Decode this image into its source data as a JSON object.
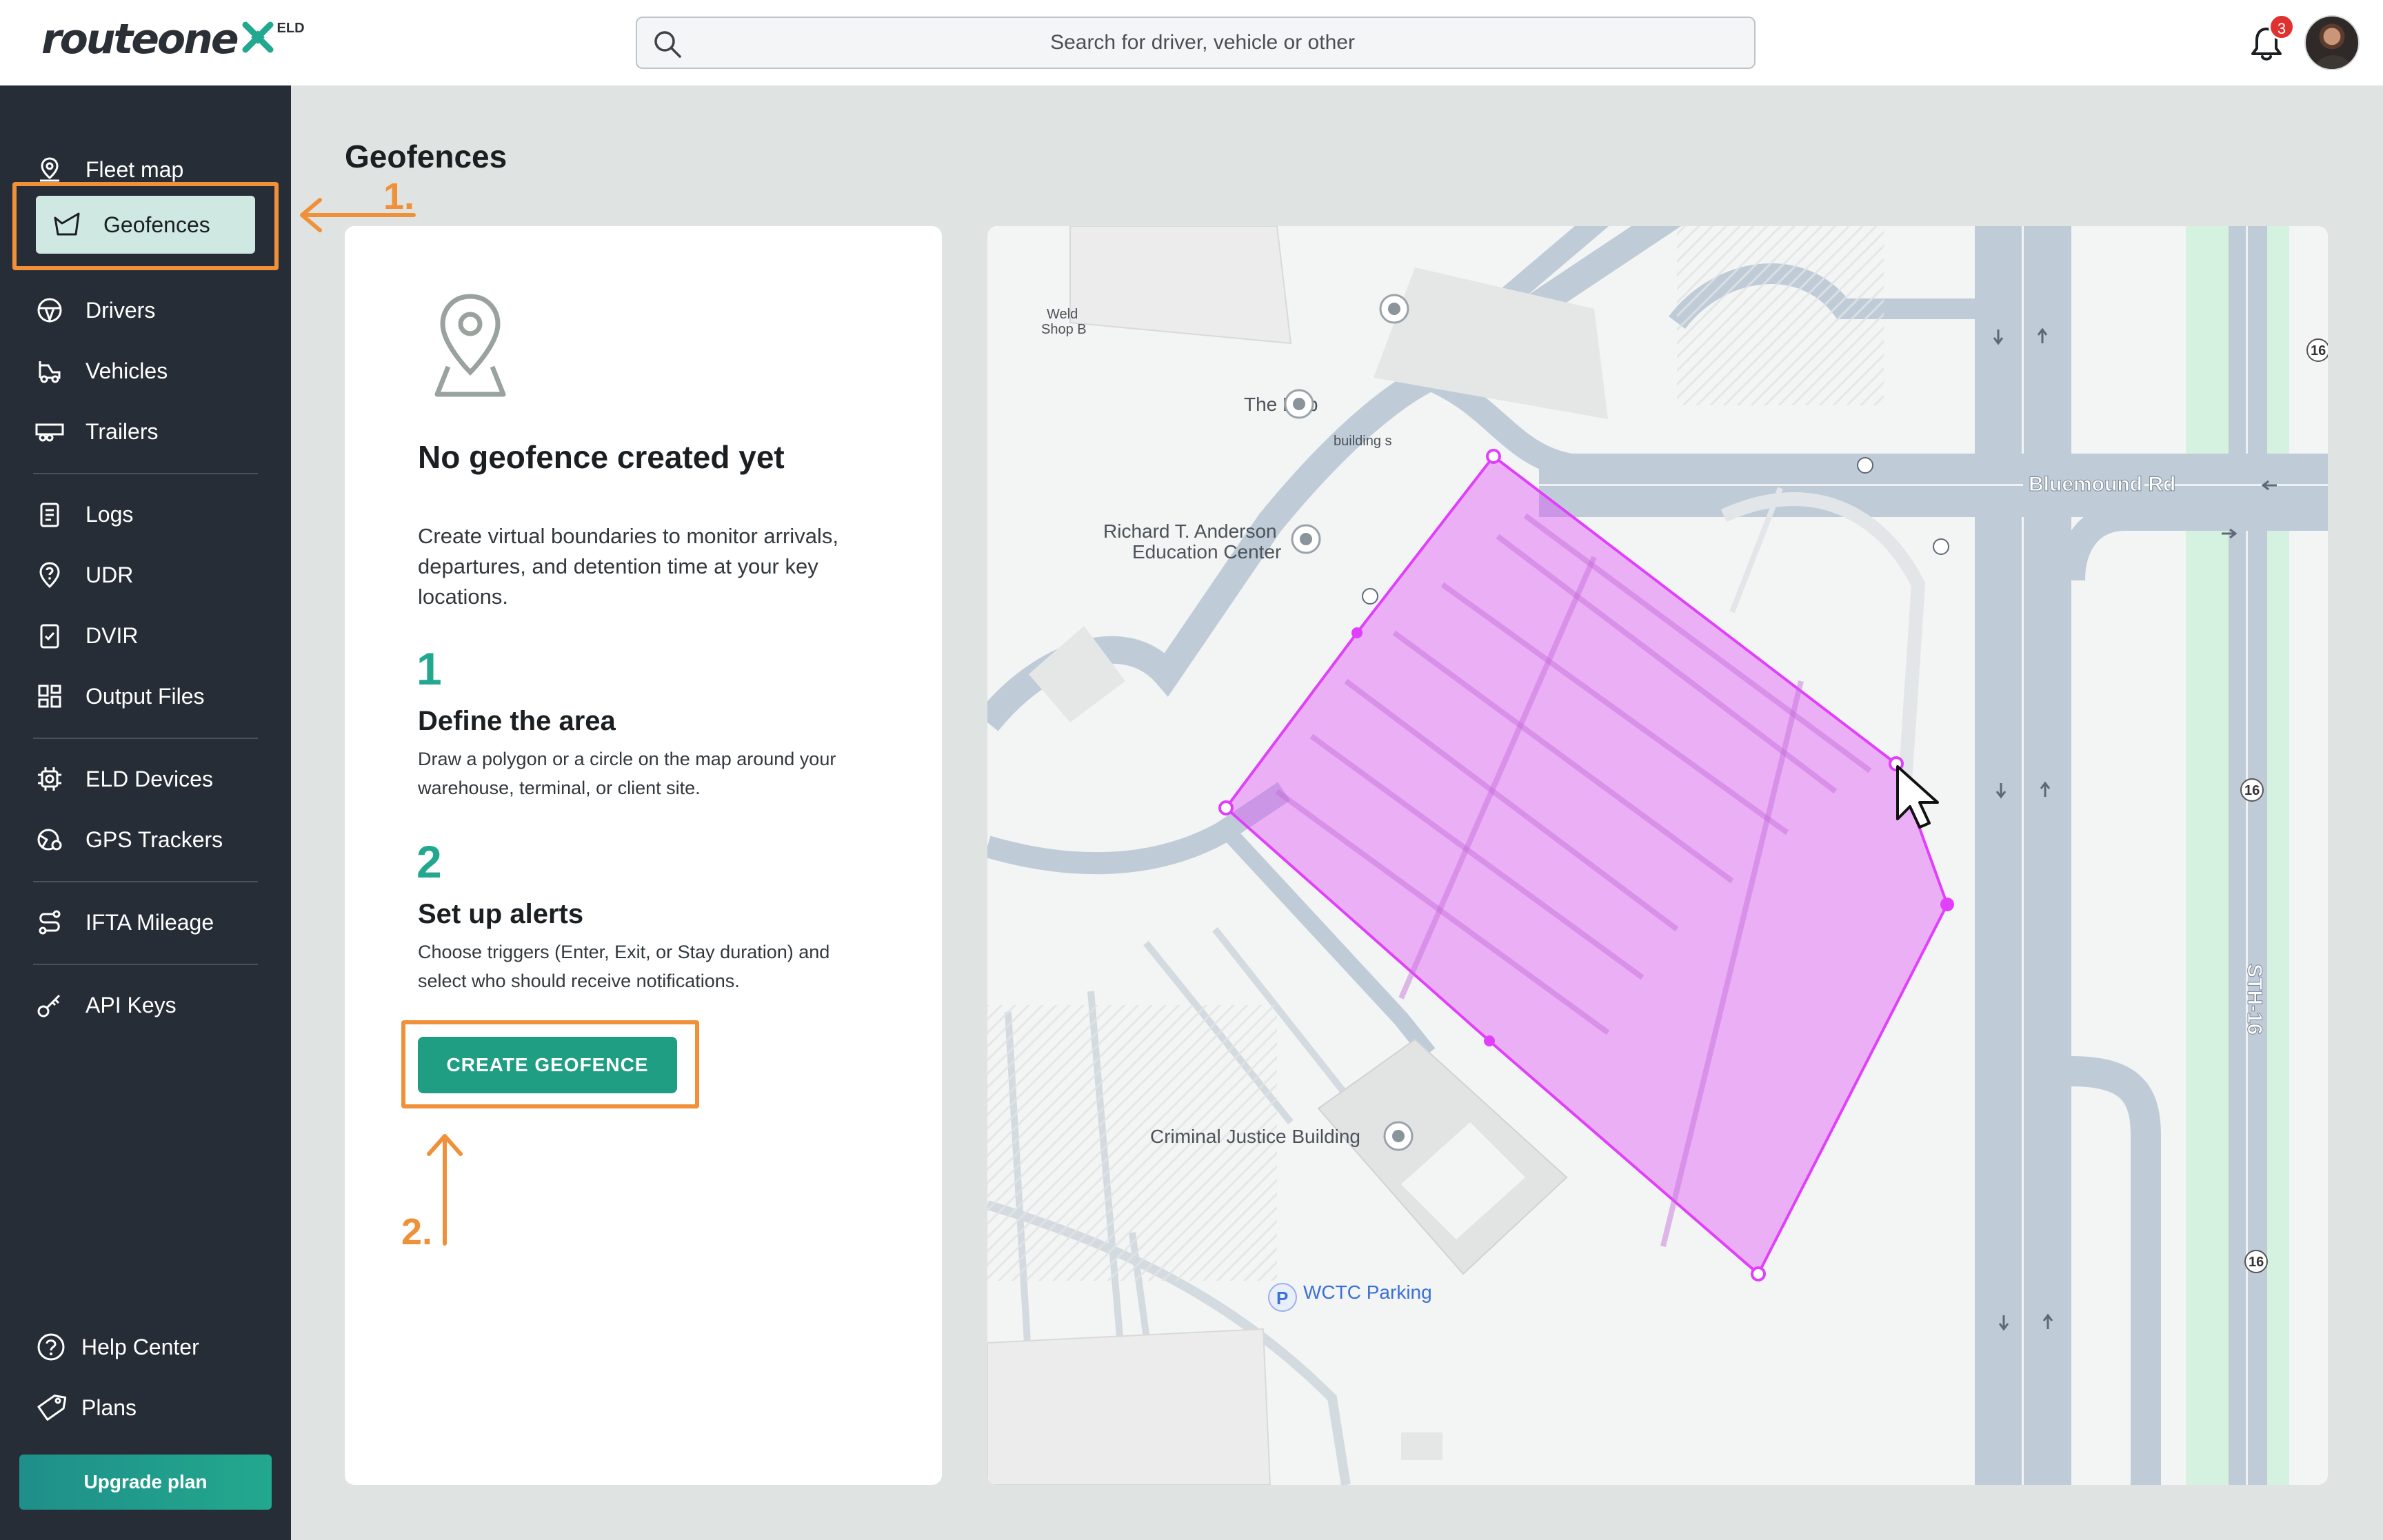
{
  "header": {
    "logo_text": "routeone",
    "logo_badge": "ELD",
    "search_placeholder": "Search for driver, vehicle or other",
    "notification_count": "3"
  },
  "sidebar": {
    "items": [
      {
        "label": "Fleet map",
        "icon": "map-pin-icon"
      },
      {
        "label": "Geofences",
        "icon": "geofence-icon",
        "active": true
      },
      {
        "label": "Drivers",
        "icon": "steering-wheel-icon"
      },
      {
        "label": "Vehicles",
        "icon": "truck-icon"
      },
      {
        "label": "Trailers",
        "icon": "trailer-icon"
      },
      {
        "label": "Logs",
        "icon": "clipboard-icon"
      },
      {
        "label": "UDR",
        "icon": "question-pin-icon"
      },
      {
        "label": "DVIR",
        "icon": "checklist-icon"
      },
      {
        "label": "Output Files",
        "icon": "grid-icon"
      },
      {
        "label": "ELD Devices",
        "icon": "device-icon"
      },
      {
        "label": "GPS Trackers",
        "icon": "tracker-icon"
      },
      {
        "label": "IFTA Mileage",
        "icon": "route-icon"
      },
      {
        "label": "API Keys",
        "icon": "key-icon"
      }
    ],
    "footer": [
      {
        "label": "Help Center",
        "icon": "help-icon"
      },
      {
        "label": "Plans",
        "icon": "tag-icon"
      }
    ],
    "upgrade_label": "Upgrade plan"
  },
  "page": {
    "title": "Geofences"
  },
  "empty_state": {
    "heading": "No geofence created yet",
    "description": "Create virtual boundaries to monitor arrivals, departures, and detention time at your key locations.",
    "steps": [
      {
        "number": "1",
        "title": "Define the area",
        "text": "Draw a polygon or a circle on the map around your warehouse, terminal, or client site."
      },
      {
        "number": "2",
        "title": "Set up alerts",
        "text": "Choose triggers (Enter, Exit, or Stay duration) and select who should receive notifications."
      }
    ],
    "button_label": "CREATE GEOFENCE"
  },
  "annotations": {
    "first": "1.",
    "second": "2."
  },
  "map": {
    "labels": {
      "road_bluemound": "Bluemound Rd",
      "road_sth16": "STH-16",
      "hub": "The Hub",
      "anderson_1": "Richard T. Anderson",
      "anderson_2": "Education Center",
      "criminal_justice": "Criminal Justice Building",
      "wctc_parking": "WCTC Parking",
      "weld_shop_1": "Weld",
      "weld_shop_2": "Shop B",
      "building_s": "building s",
      "route_shield": "16"
    },
    "geofence_color": "#e040fb"
  },
  "colors": {
    "accent": "#1f9e83",
    "sidebar_bg": "#272d37",
    "annotation": "#f0913a"
  }
}
